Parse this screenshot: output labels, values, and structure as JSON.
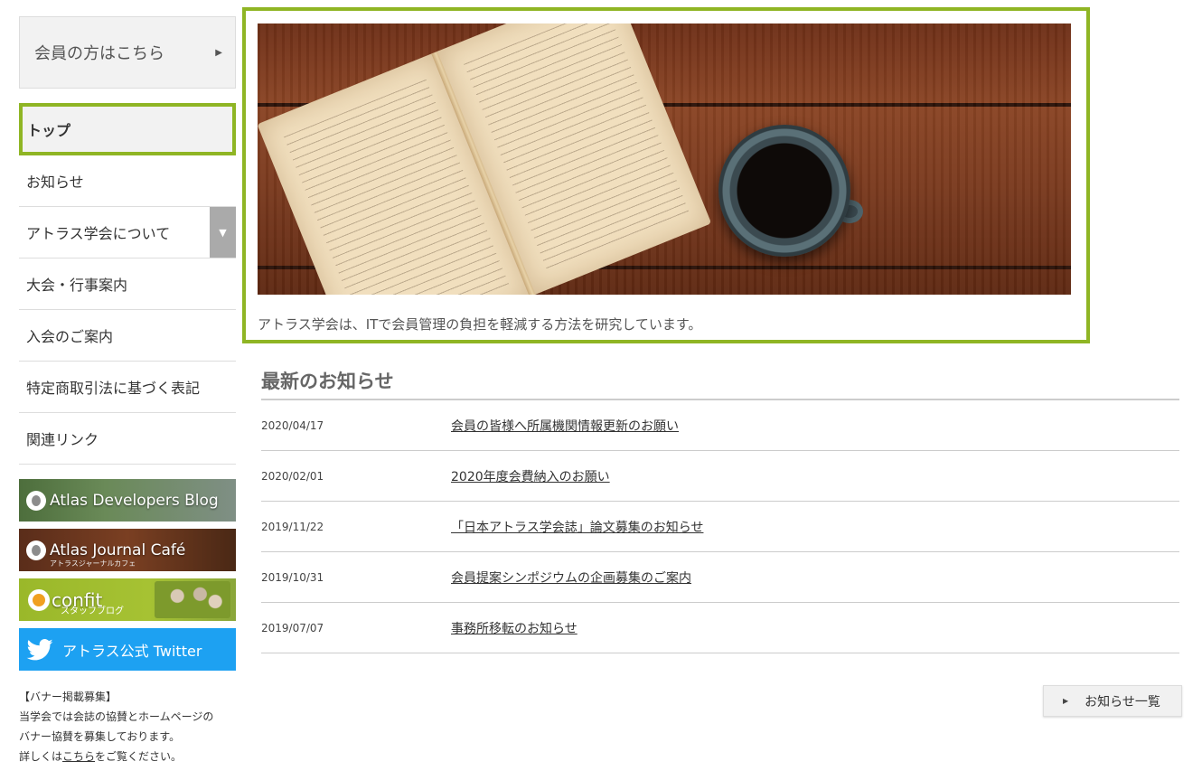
{
  "member_box": {
    "label": "会員の方はこちら",
    "arrow": "▶"
  },
  "nav": {
    "items": [
      {
        "label": "トップ"
      },
      {
        "label": "お知らせ"
      },
      {
        "label": "アトラス学会について",
        "toggle": "▼"
      },
      {
        "label": "大会・行事案内"
      },
      {
        "label": "入会のご案内"
      },
      {
        "label": "特定商取引法に基づく表記"
      },
      {
        "label": "関連リンク"
      }
    ]
  },
  "banners": {
    "blog": {
      "title": "Atlas Developers Blog"
    },
    "journal": {
      "title": "Atlas Journal Café",
      "sub": "アトラスジャーナルカフェ"
    },
    "confit": {
      "title": "confit",
      "sub": "スタッフブログ"
    },
    "twitter": {
      "title": "アトラス公式 Twitter"
    }
  },
  "ad": {
    "line1": "【バナー掲載募集】",
    "line2": "当学会では会誌の協賛とホームページの",
    "line3": "バナー協賛を募集しております。",
    "line4_pre": "詳しくは",
    "line4_link": "こちら",
    "line4_post": "をご覧ください。"
  },
  "hero": {
    "caption": "アトラス学会は、ITで会員管理の負担を軽減する方法を研究しています。"
  },
  "news": {
    "title": "最新のお知らせ",
    "items": [
      {
        "date": "2020/04/17",
        "title": "会員の皆様へ所属機関情報更新のお願い"
      },
      {
        "date": "2020/02/01",
        "title": "2020年度会費納入のお願い"
      },
      {
        "date": "2019/11/22",
        "title": "「日本アトラス学会誌」論文募集のお知らせ"
      },
      {
        "date": "2019/10/31",
        "title": "会員提案シンポジウムの企画募集のご案内"
      },
      {
        "date": "2019/07/07",
        "title": "事務所移転のお知らせ"
      }
    ],
    "more_label": "お知らせ一覧",
    "more_arrow": "▶"
  },
  "colors": {
    "accent": "#8fb524",
    "twitter": "#1da1f2"
  }
}
